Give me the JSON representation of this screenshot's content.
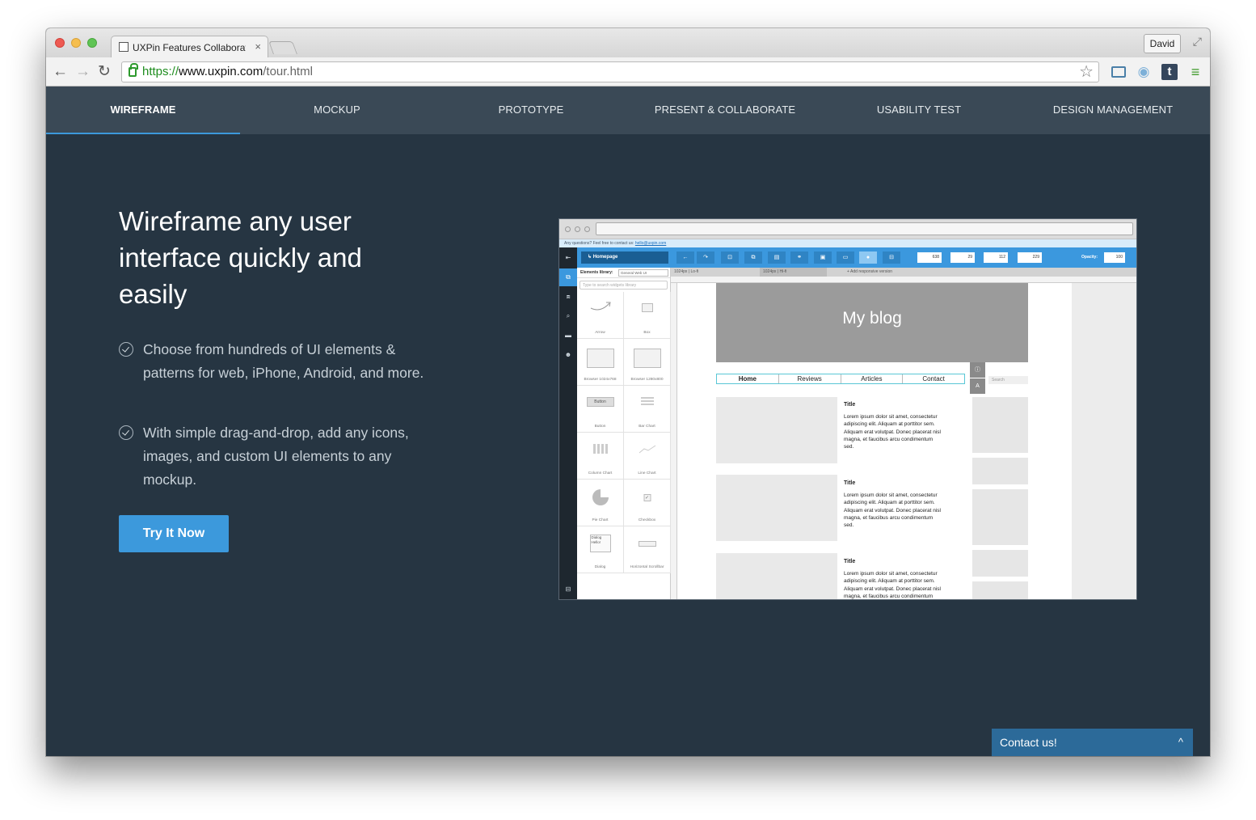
{
  "browser": {
    "tab_title": "UXPin Features Collaborati",
    "tab_close": "×",
    "user": "David",
    "url_scheme": "https://",
    "url_host": "www.uxpin.com",
    "url_path": "/tour.html",
    "icons": [
      "back-icon",
      "forward-icon",
      "reload-icon",
      "lock-icon",
      "star-icon",
      "screen-capture-icon",
      "camera-icon",
      "tumblr-icon",
      "menu-icon"
    ]
  },
  "nav": {
    "items": [
      "WIREFRAME",
      "MOCKUP",
      "PROTOTYPE",
      "PRESENT & COLLABORATE",
      "USABILITY TEST",
      "DESIGN MANAGEMENT"
    ],
    "active_index": 0
  },
  "hero": {
    "headline": "Wireframe any user interface quickly and easily",
    "features": [
      "Choose from hundreds of UI elements & patterns for web, iPhone, Android, and more.",
      "With simple drag-and-drop, add any icons, images, and custom UI elements to any mockup."
    ],
    "cta": "Try It Now"
  },
  "preview": {
    "notice_text": "Any questions? Feel free to contact us:",
    "notice_link": "hello@uxpin.com",
    "homepage": "Homepage",
    "fields": {
      "w": "638",
      "h": "29",
      "x": "112",
      "y": "229",
      "opacity_label": "Opacity:",
      "opacity": "100"
    },
    "library_label": "Elements library:",
    "library_select": "General Web UI",
    "search_placeholder": "Type to search widgets library",
    "widgets": [
      "Arrow",
      "Box",
      "Browser 1024x768",
      "Browser 1280x800",
      "Button",
      "Bar Chart",
      "Column Chart",
      "Line Chart",
      "Pie Chart",
      "Checkbox",
      "Dialog",
      "Horizontal Scrollbar"
    ],
    "widget_button_text": "Button",
    "widget_dialog_text": "Dialog",
    "widget_dialog_hello": "Hello!",
    "canvas_tabs": [
      "1024px | Lo-fi",
      "1024px | Hi-fi",
      "+ Add responsive version"
    ],
    "blog_title": "My blog",
    "blog_nav": [
      "Home",
      "Reviews",
      "Articles",
      "Contact"
    ],
    "search": "Search",
    "article_title": "Title",
    "article_body": "Lorem ipsum dolor sit amet, consectetur adipiscing elit. Aliquam at porttitor sem. Aliquam erat volutpat. Donec placerat nisl magna, et faucibus arcu condimentum sed.",
    "accent": "#3b98de"
  },
  "contact": {
    "label": "Contact us!",
    "chevron": "^"
  },
  "colors": {
    "page_bg": "#263542",
    "nav_bg": "#3a4956",
    "accent": "#3c99dc",
    "contact_bg": "#2c6a99"
  }
}
